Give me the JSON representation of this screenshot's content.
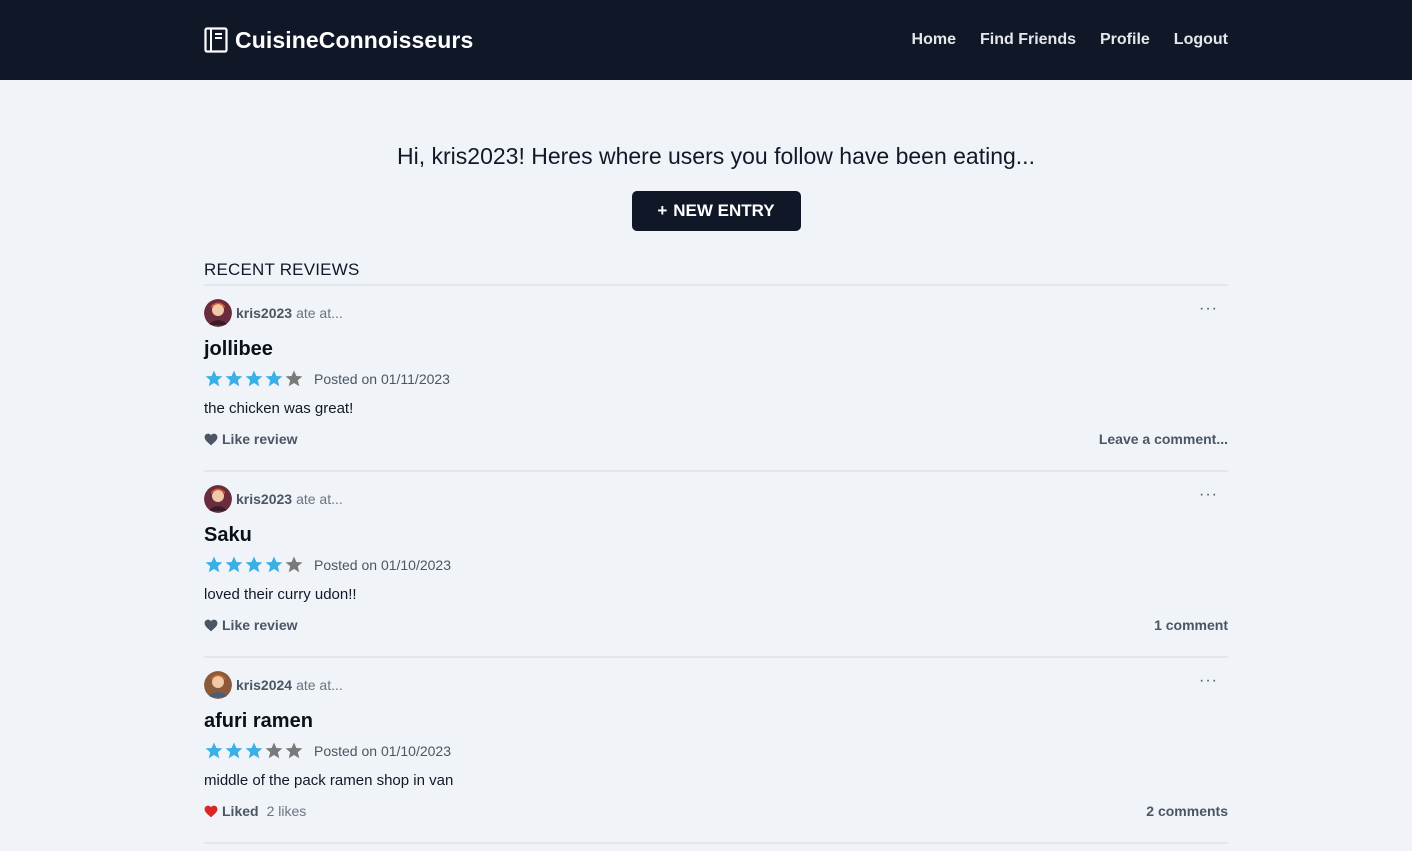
{
  "app": {
    "name": "CuisineConnoisseurs"
  },
  "nav": {
    "home": "Home",
    "find_friends": "Find Friends",
    "profile": "Profile",
    "logout": "Logout"
  },
  "colors": {
    "navbar": "#101827",
    "background": "#f0f4f8",
    "star_filled": "#3bb0e7",
    "star_empty": "#7a7a7a",
    "liked_heart": "#dc2626",
    "heart": "#4b5563"
  },
  "greeting": "Hi, kris2023! Heres where users you follow have been eating...",
  "new_entry": {
    "plus": "+",
    "label": "NEW ENTRY"
  },
  "section_title": "RECENT REVIEWS",
  "reviews": [
    {
      "username": "kris2023",
      "ate_at": "ate at...",
      "restaurant": "jollibee",
      "rating": 4,
      "max_rating": 5,
      "posted": "Posted on 01/11/2023",
      "text": "the chicken was great!",
      "like_label": "Like review",
      "liked": false,
      "likes_text": "",
      "comment_text": "Leave a comment...",
      "more": "···",
      "avatar_icon": "user-avatar-icon"
    },
    {
      "username": "kris2023",
      "ate_at": "ate at...",
      "restaurant": "Saku",
      "rating": 4,
      "max_rating": 5,
      "posted": "Posted on 01/10/2023",
      "text": "loved their curry udon!!",
      "like_label": "Like review",
      "liked": false,
      "likes_text": "",
      "comment_text": "1 comment",
      "more": "···",
      "avatar_icon": "user-avatar-icon"
    },
    {
      "username": "kris2024",
      "ate_at": "ate at...",
      "restaurant": "afuri ramen",
      "rating": 3,
      "max_rating": 5,
      "posted": "Posted on 01/10/2023",
      "text": "middle of the pack ramen shop in van",
      "like_label": "Liked",
      "liked": true,
      "likes_text": "2 likes",
      "comment_text": "2 comments",
      "more": "···",
      "avatar_icon": "user-avatar-icon"
    }
  ]
}
